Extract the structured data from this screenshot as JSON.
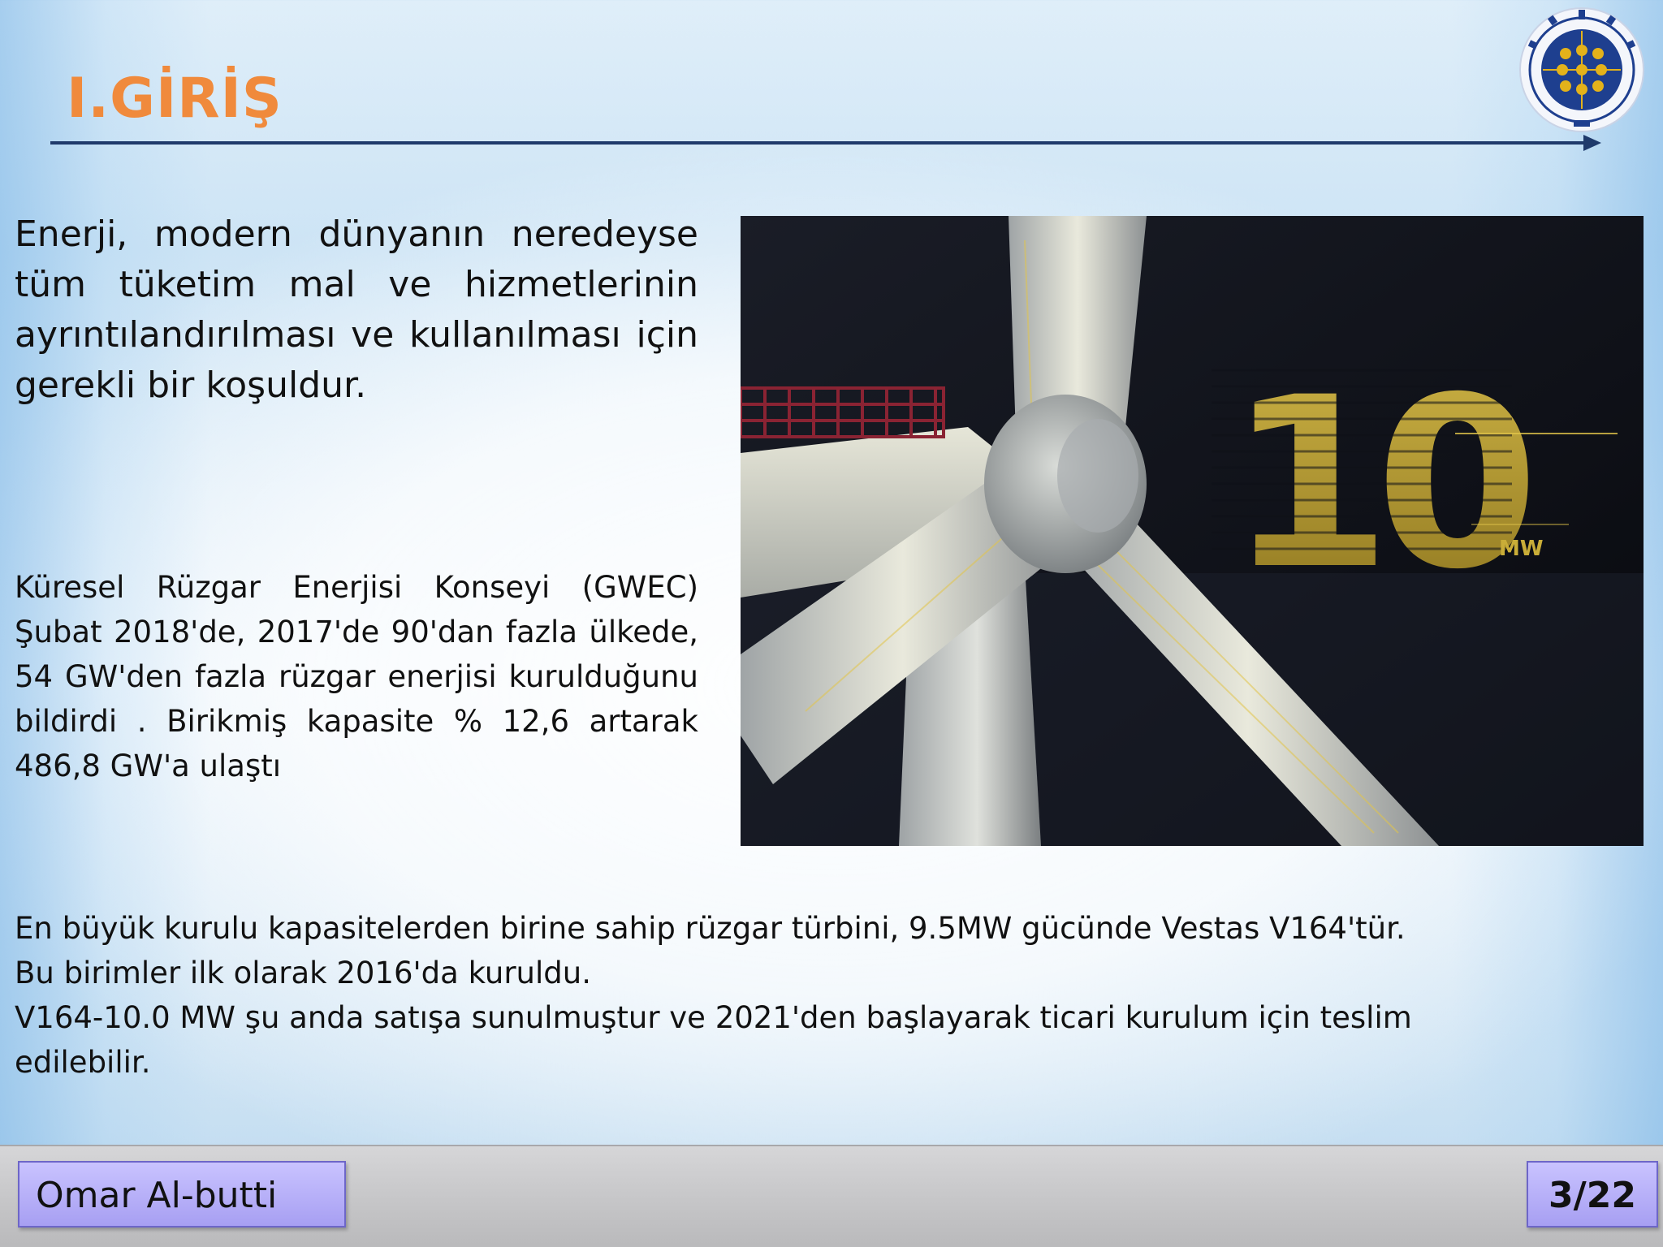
{
  "header": {
    "title": "I.GİRİŞ"
  },
  "content": {
    "paragraph_1": "Enerji, modern dünyanın neredeyse tüm tüketim mal ve hizmetlerinin ayrıntılandırılması ve kullanılması için gerekli bir koşuldur.",
    "paragraph_2": "Küresel Rüzgar Enerjisi Konseyi (GWEC) Şubat 2018'de, 2017'de 90'dan fazla ülkede, 54 GW'den fazla rüzgar enerjisi kurulduğunu bildirdi . Birikmiş kapasite % 12,6 artarak 486,8 GW'a ulaştı",
    "paragraph_3_lines": [
      "En büyük kurulu kapasitelerden birine sahip rüzgar türbini, 9.5MW gücünde Vestas V164'tür.",
      "Bu birimler ilk olarak 2016'da kuruldu.",
      "V164-10.0 MW şu anda satışa sunulmuştur ve 2021'den  başlayarak ticari kurulum için teslim",
      "edilebilir."
    ]
  },
  "image": {
    "overlay_number": "10",
    "overlay_unit": "MW"
  },
  "footer": {
    "author": "Omar Al-butti",
    "page": "3/22"
  },
  "colors": {
    "title": "#f08a3c",
    "rule": "#1f3a6b",
    "footer_box": "#b3acf5",
    "logo_blue": "#1e3f8f",
    "logo_gold": "#e3b21b"
  },
  "icons": {
    "logo": "university-seal-logo"
  }
}
